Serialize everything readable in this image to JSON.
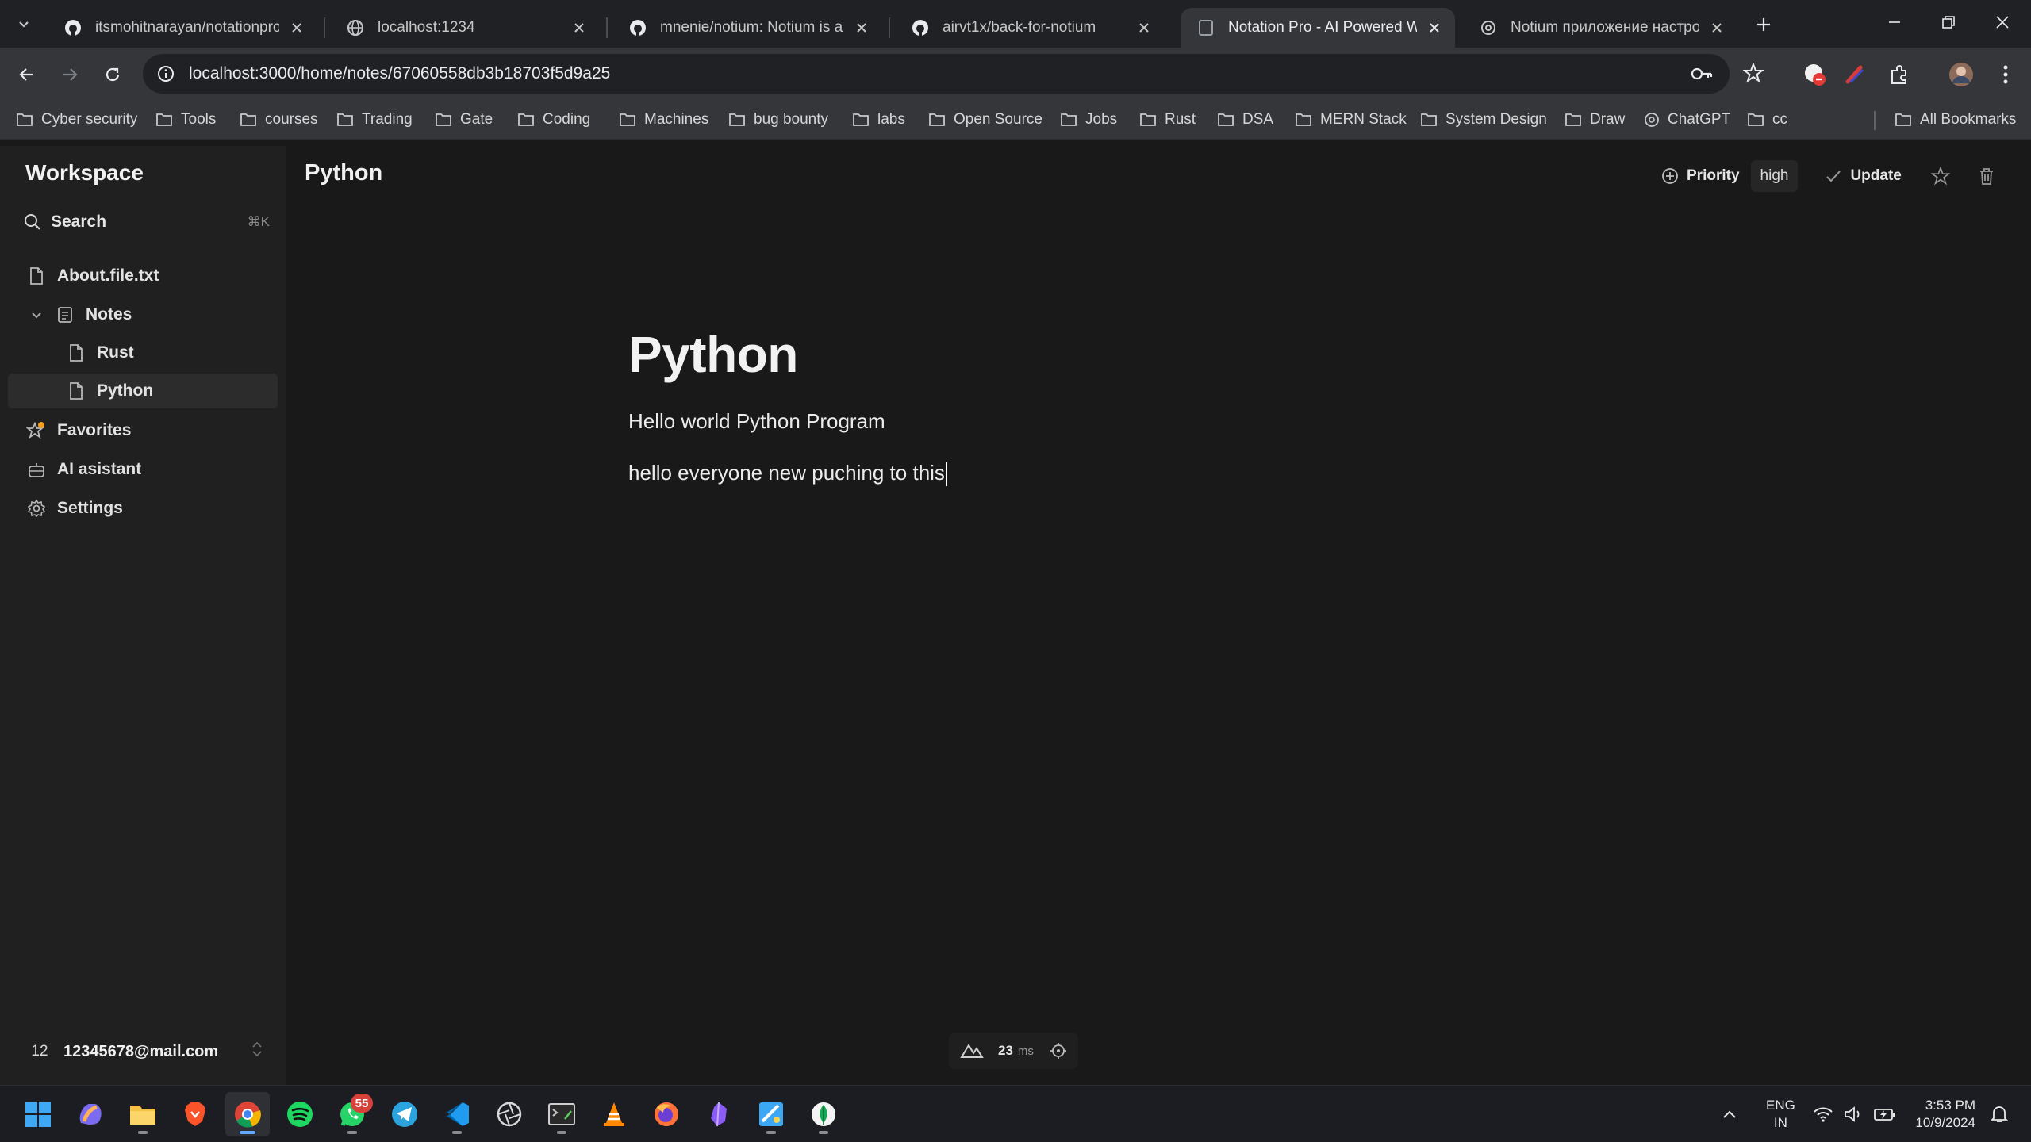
{
  "browser": {
    "tabs": [
      {
        "title": "itsmohitnarayan/notationpro: A",
        "favicon": "github-icon",
        "active": false
      },
      {
        "title": "localhost:1234",
        "favicon": "globe-icon",
        "active": false
      },
      {
        "title": "mnenie/notium: Notium is a clo",
        "favicon": "github-icon",
        "active": false
      },
      {
        "title": "airvt1x/back-for-notium",
        "favicon": "github-icon",
        "active": false
      },
      {
        "title": "Notation Pro - AI Powered Web",
        "favicon": "page-icon",
        "active": true
      },
      {
        "title": "Notium приложение настройк",
        "favicon": "openai-icon",
        "active": false
      }
    ],
    "url": "localhost:3000/home/notes/67060558db3b18703f5d9a25",
    "bookmarks": [
      "Cyber security",
      "Tools",
      "courses",
      "Trading",
      "Gate",
      "Coding",
      "Machines",
      "bug bounty",
      "labs",
      "Open Source",
      "Jobs",
      "Rust",
      "DSA",
      "MERN Stack",
      "System Design",
      "Draw",
      "ChatGPT",
      "cc"
    ],
    "all_bookmarks": "All Bookmarks"
  },
  "sidebar": {
    "workspace_title": "Workspace",
    "search_label": "Search",
    "search_shortcut": "⌘K",
    "items": [
      {
        "label": "About.file.txt",
        "icon": "file-icon"
      },
      {
        "label": "Notes",
        "icon": "notes-icon"
      },
      {
        "label": "Rust",
        "icon": "file-icon"
      },
      {
        "label": "Python",
        "icon": "file-icon"
      },
      {
        "label": "Favorites",
        "icon": "star-icon"
      },
      {
        "label": "AI asistant",
        "icon": "bot-icon"
      },
      {
        "label": "Settings",
        "icon": "gear-icon"
      }
    ],
    "user": {
      "avatar_text": "12",
      "email": "12345678@mail.com"
    }
  },
  "header": {
    "title": "Python",
    "priority_label": "Priority",
    "priority_value": "high",
    "update_label": "Update"
  },
  "document": {
    "title": "Python",
    "paragraphs": [
      "Hello world Python Program",
      "hello everyone new puching to this"
    ]
  },
  "perf": {
    "value": "23",
    "unit": "ms"
  },
  "taskbar": {
    "whatsapp_badge": "55",
    "language": {
      "line1": "ENG",
      "line2": "IN"
    },
    "time": "3:53 PM",
    "date": "10/9/2024"
  },
  "colors": {
    "accent": "#62a8ff",
    "background": "#191919",
    "sidebar": "#202020",
    "badge": "#d8413a"
  }
}
